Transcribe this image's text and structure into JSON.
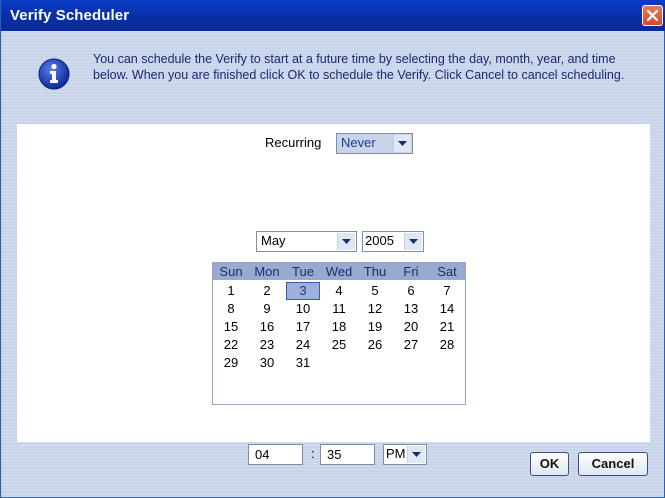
{
  "window": {
    "title": "Verify Scheduler"
  },
  "info": {
    "icon": "info-icon",
    "message": "You can schedule the Verify to start at a future time by selecting the day, month, year, and time below.  When you are finished click OK to schedule the Verify.  Click Cancel to cancel scheduling."
  },
  "recurring": {
    "label": "Recurring",
    "value": "Never"
  },
  "calendar": {
    "month": "May",
    "year": "2005",
    "day_names": [
      "Sun",
      "Mon",
      "Tue",
      "Wed",
      "Thu",
      "Fri",
      "Sat"
    ],
    "weeks": [
      [
        "1",
        "2",
        "3",
        "4",
        "5",
        "6",
        "7"
      ],
      [
        "8",
        "9",
        "10",
        "11",
        "12",
        "13",
        "14"
      ],
      [
        "15",
        "16",
        "17",
        "18",
        "19",
        "20",
        "21"
      ],
      [
        "22",
        "23",
        "24",
        "25",
        "26",
        "27",
        "28"
      ],
      [
        "29",
        "30",
        "31",
        "",
        "",
        "",
        ""
      ]
    ],
    "selected_day": "3"
  },
  "time": {
    "hour": "04",
    "separator": ":",
    "minute": "35",
    "ampm": "PM"
  },
  "buttons": {
    "ok": "OK",
    "cancel": "Cancel"
  },
  "colors": {
    "title_bar": "#0a3cc8",
    "selection": "#9db0da",
    "header": "#98aad0"
  }
}
